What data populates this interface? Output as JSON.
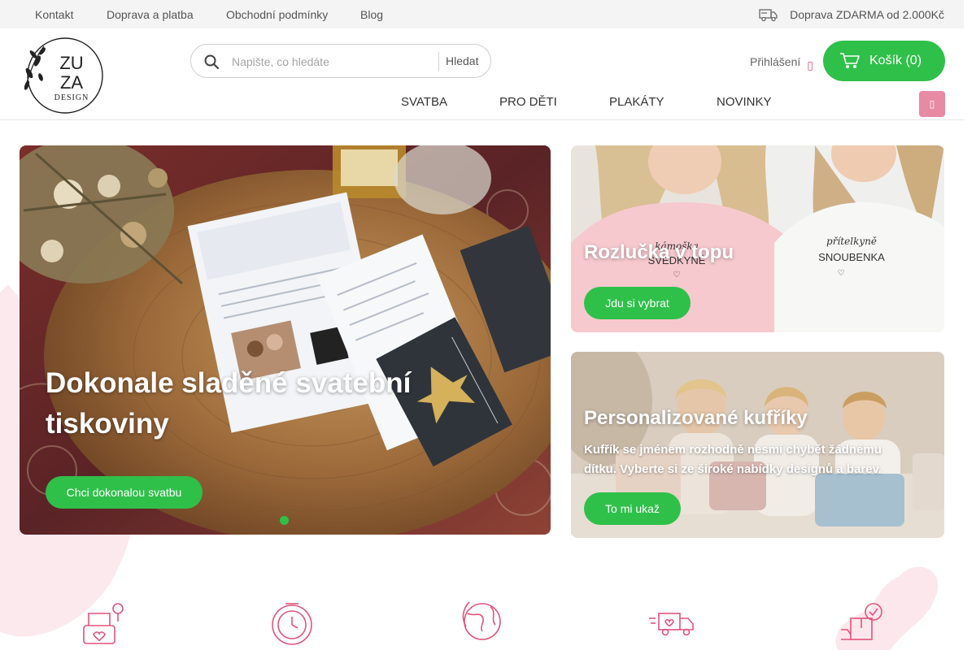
{
  "topbar": {
    "links": [
      "Kontakt",
      "Doprava a platba",
      "Obchodní podmínky",
      "Blog"
    ],
    "shipping_icon": "delivery-truck-icon",
    "shipping_text": "Doprava ZDARMA od 2.000Kč"
  },
  "logo": {
    "line1": "ZU",
    "line2": "ZA",
    "line3": "DESIGN"
  },
  "search": {
    "placeholder": "Napište, co hledáte",
    "value": "",
    "button": "Hledat",
    "icon": "search-icon"
  },
  "account": {
    "login": "Přihlášení",
    "login_icon": "user-icon"
  },
  "cart": {
    "label": "Košík (0)",
    "icon": "shopping-cart-icon"
  },
  "nav": {
    "items": [
      "SVATBA",
      "PRO DĚTI",
      "PLAKÁTY",
      "NOVINKY"
    ],
    "menu_icon": "menu-icon"
  },
  "hero": {
    "title": "Dokonale sladěné svatební tiskoviny",
    "button": "Chci dokonalou svatbu",
    "slide_indicator": "slide-dot"
  },
  "promo1": {
    "title": "Rozlučka v topu",
    "button": "Jdu si vybrat",
    "shirt_left_top": "kámoška",
    "shirt_left_bottom": "SVEDKYNĚ",
    "shirt_right_top": "přítelkyně",
    "shirt_right_bottom": "SNOUBENKA"
  },
  "promo2": {
    "title": "Personalizované kufříky",
    "text": "Kufřík se jménem rozhodně nesmí chybět žádnému dítku. Vyberte si ze široké nabídky designů a barev.",
    "button": "To mi ukaž"
  },
  "features": {
    "icons": [
      "handmade-gift-icon",
      "stopwatch-icon",
      "eco-globe-icon",
      "fast-delivery-icon",
      "package-check-icon"
    ]
  },
  "colors": {
    "accent_green": "#2fc04a",
    "accent_pink": "#e78aa3",
    "topbar_bg": "#f4f4f4"
  }
}
